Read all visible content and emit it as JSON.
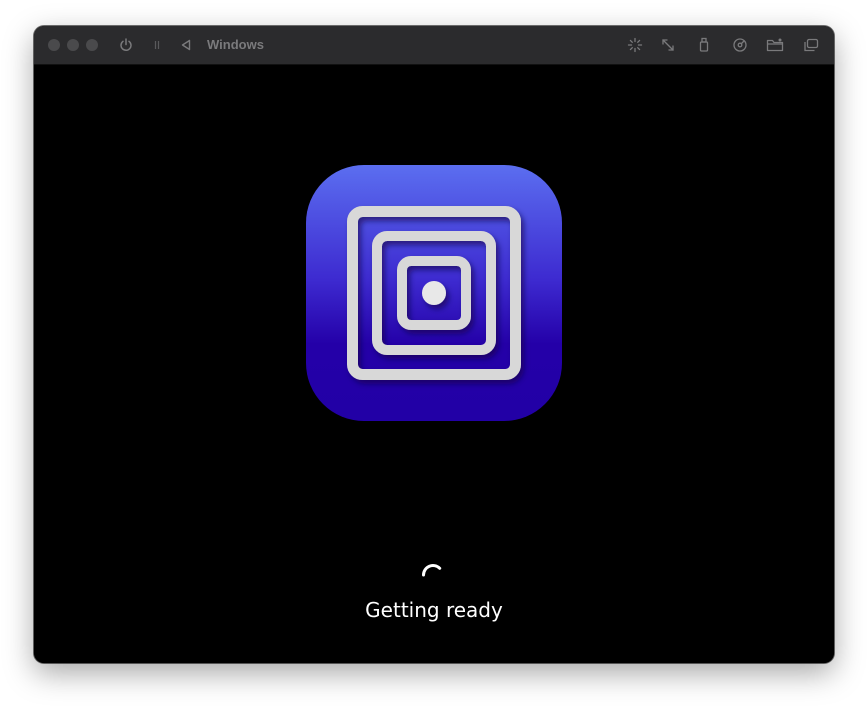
{
  "window": {
    "title": "Windows",
    "titlebar_color": "#2b2b2d",
    "background_color": "#000000"
  },
  "toolbar": {
    "left_icons": [
      "power-icon",
      "pause-icon",
      "back-icon"
    ],
    "right_icons": [
      "capture-input-icon",
      "resize-icon",
      "usb-icon",
      "drive-icon",
      "shared-folder-icon",
      "windows-icon"
    ]
  },
  "content": {
    "logo": "utm-app-logo",
    "logo_colors": {
      "top": "#5b6ef0",
      "bottom": "#2400a8",
      "frame": "#d9d9d9"
    },
    "status": "Getting ready"
  }
}
